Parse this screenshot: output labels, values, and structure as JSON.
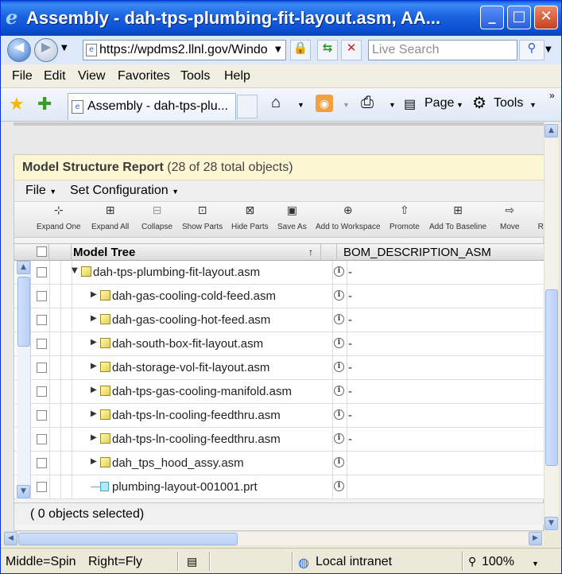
{
  "window": {
    "title": "Assembly - dah-tps-plumbing-fit-layout.asm, AA...",
    "minimize": "_",
    "maximize": "□",
    "close": "✕"
  },
  "address": {
    "url": "https://wpdms2.llnl.gov/Windo",
    "search_placeholder": "Live Search"
  },
  "menu": [
    "File",
    "Edit",
    "View",
    "Favorites",
    "Tools",
    "Help"
  ],
  "tab": {
    "label": "Assembly - dah-tps-plu..."
  },
  "commands": {
    "page": "Page",
    "tools": "Tools"
  },
  "report": {
    "title": "Model Structure Report",
    "count": "(28 of 28 total objects)",
    "menu": {
      "file": "File",
      "set_configuration": "Set Configuration"
    },
    "toolbar": [
      "Expand One",
      "Expand All",
      "Collapse",
      "Show Parts",
      "Hide Parts",
      "Save As",
      "Add to Workspace",
      "Promote",
      "Add To Baseline",
      "Move",
      "Re"
    ],
    "columns": {
      "tree": "Model Tree",
      "sort": "↑",
      "bom": "BOM_DESCRIPTION_ASM"
    },
    "rows": [
      {
        "name": "dah-tps-plumbing-fit-layout.asm",
        "bom": "-",
        "type": "asm",
        "level": 0,
        "expanded": true
      },
      {
        "name": "dah-gas-cooling-cold-feed.asm",
        "bom": "-",
        "type": "asm",
        "level": 1
      },
      {
        "name": "dah-gas-cooling-hot-feed.asm",
        "bom": "-",
        "type": "asm",
        "level": 1
      },
      {
        "name": "dah-south-box-fit-layout.asm",
        "bom": "-",
        "type": "asm",
        "level": 1
      },
      {
        "name": "dah-storage-vol-fit-layout.asm",
        "bom": "-",
        "type": "asm",
        "level": 1
      },
      {
        "name": "dah-tps-gas-cooling-manifold.asm",
        "bom": "-",
        "type": "asm",
        "level": 1
      },
      {
        "name": "dah-tps-ln-cooling-feedthru.asm",
        "bom": "-",
        "type": "asm",
        "level": 1
      },
      {
        "name": "dah-tps-ln-cooling-feedthru.asm",
        "bom": "-",
        "type": "asm",
        "level": 1
      },
      {
        "name": "dah_tps_hood_assy.asm",
        "bom": "",
        "type": "asm",
        "level": 1
      },
      {
        "name": "plumbing-layout-001001.prt",
        "bom": "",
        "type": "prt",
        "level": 1
      }
    ],
    "selection_status": "( 0 objects selected)"
  },
  "statusbar": {
    "middle": "Middle=Spin",
    "right": "Right=Fly",
    "zone": "Local intranet",
    "zoom": "100%"
  }
}
